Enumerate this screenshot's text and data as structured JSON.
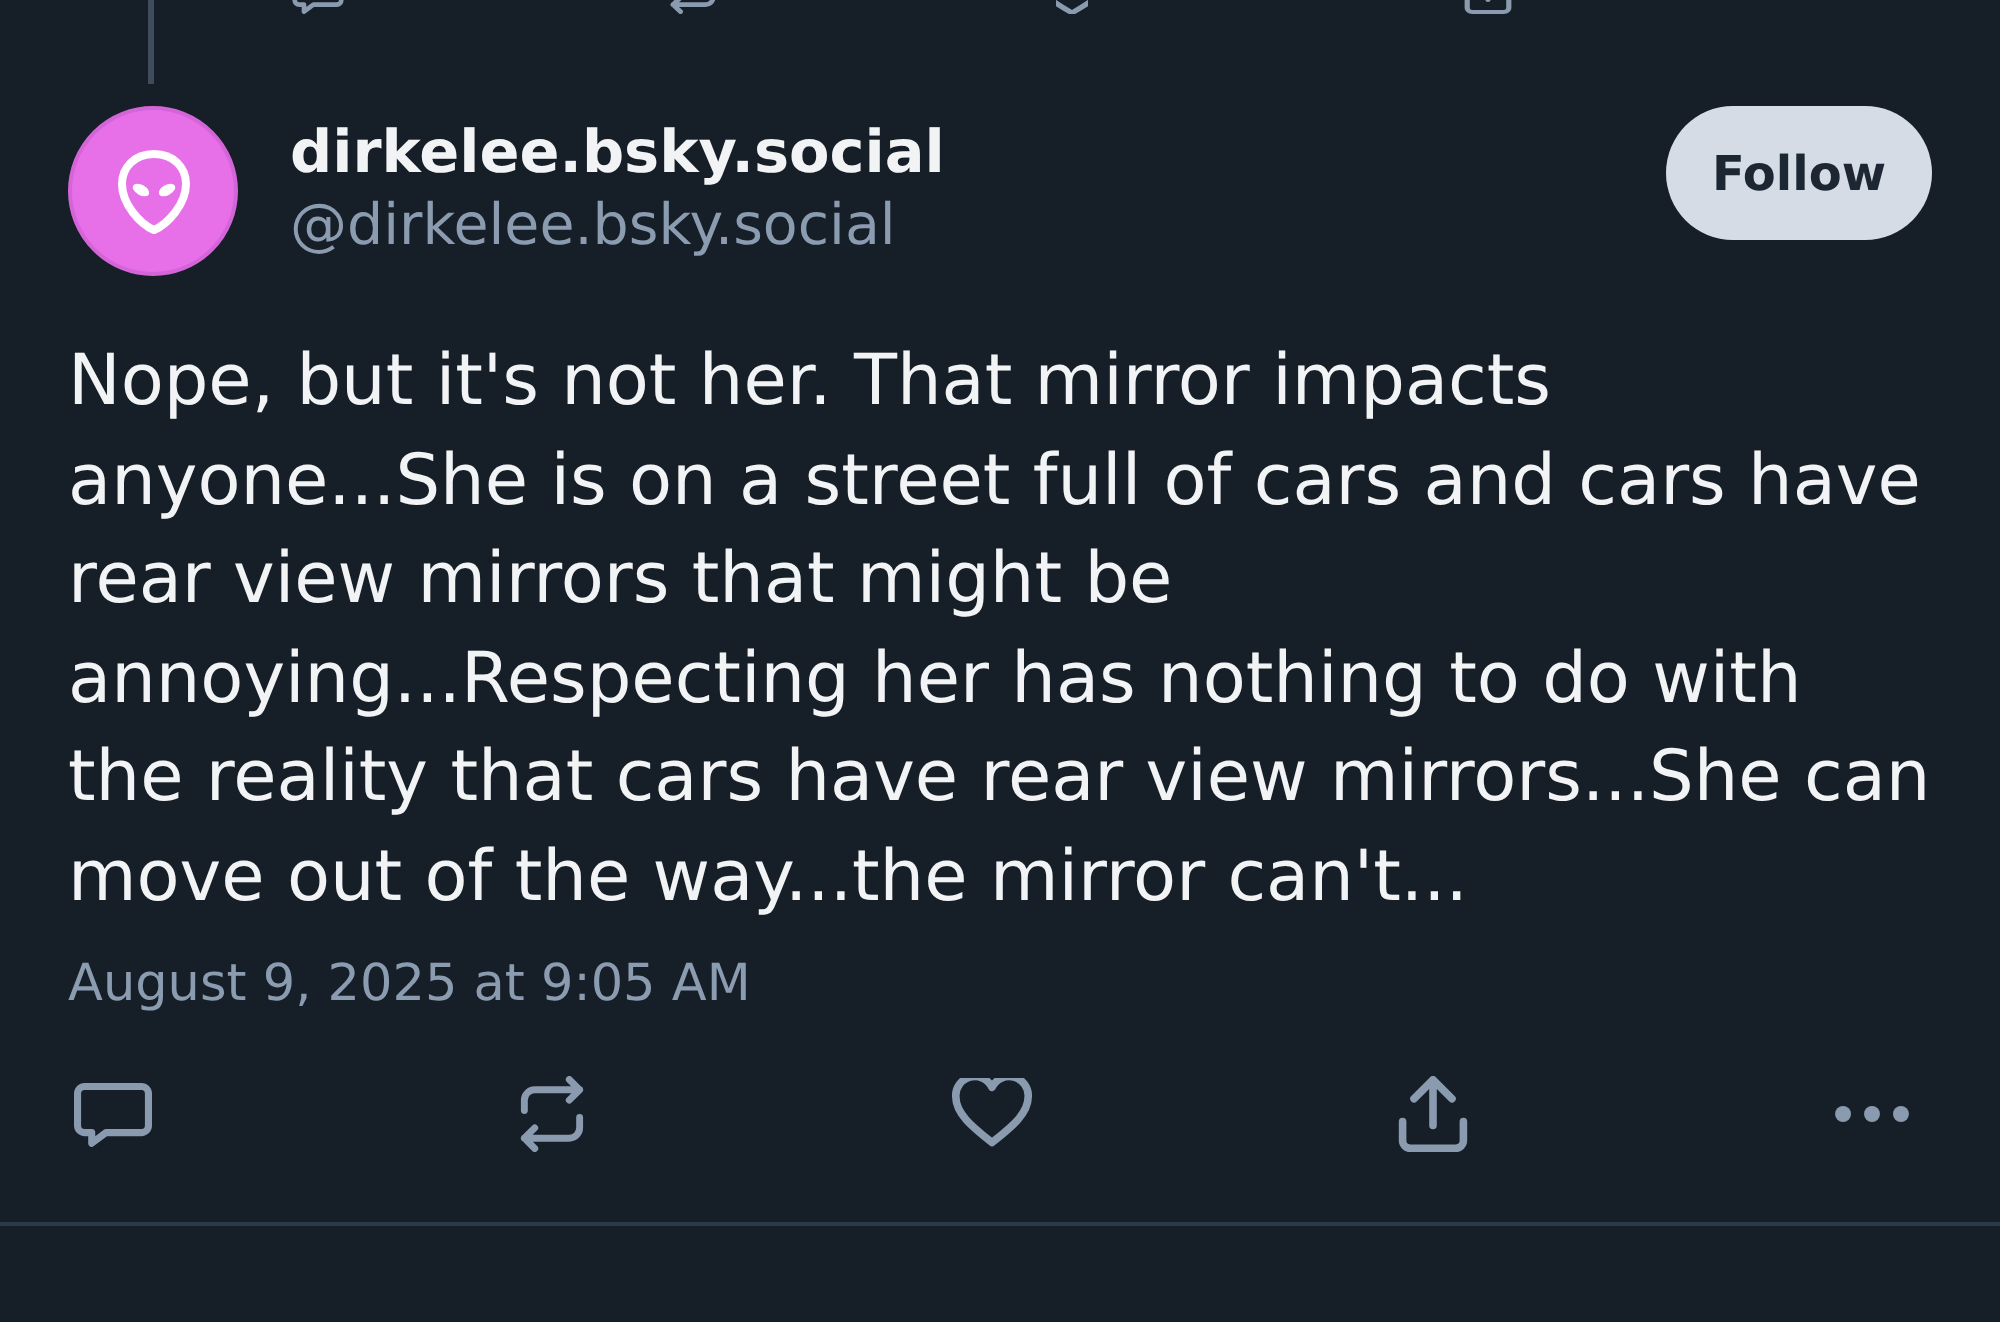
{
  "post": {
    "author": {
      "display_name": "dirkelee.bsky.social",
      "handle": "@dirkelee.bsky.social"
    },
    "follow_button": "Follow",
    "text": "Nope, but it's not her. That mirror impacts anyone...She is on a street full of cars and cars have rear view mirrors that might be annoying...Respecting her has nothing to do with the reality that cars have rear view mirrors...She can move out of the way...the mirror can't...",
    "timestamp": "August 9, 2025 at 9:05 AM"
  }
}
